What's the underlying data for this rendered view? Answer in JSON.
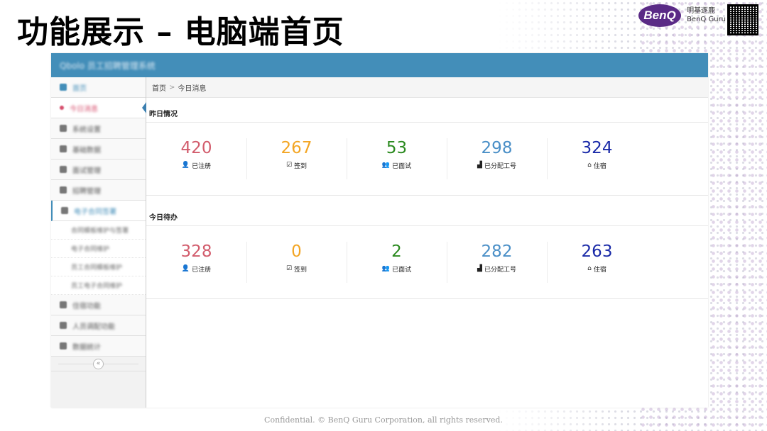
{
  "slide": {
    "title": "功能展示 – 电脑端首页",
    "brand_name": "BenQ",
    "brand_text_line1": "明基逐鹿",
    "brand_text_line2": "BenQ Guru",
    "footer": "Confidential.  © BenQ Guru Corporation, all rights reserved."
  },
  "app": {
    "title": "Qbolo 员工招聘管理系统"
  },
  "sidebar": {
    "items": [
      {
        "label": "首页"
      },
      {
        "label": "今日消息"
      },
      {
        "label": "系统设置"
      },
      {
        "label": "基础数据"
      },
      {
        "label": "面试管理"
      },
      {
        "label": "招聘管理"
      },
      {
        "label": "电子合同签署"
      }
    ],
    "sub_items": [
      {
        "label": "合同模板维护与签署"
      },
      {
        "label": "电子合同维护"
      },
      {
        "label": "员工合同模板维护"
      },
      {
        "label": "员工电子合同维护"
      }
    ],
    "items_after": [
      {
        "label": "住宿功能"
      },
      {
        "label": "人员调配功能"
      },
      {
        "label": "数据统计"
      }
    ],
    "collapse_glyph": "«"
  },
  "breadcrumb": {
    "home": "首页",
    "sep": ">",
    "current": "今日消息"
  },
  "sections": [
    {
      "title": "昨日情况",
      "stats": [
        {
          "value": "420",
          "label": "已注册",
          "icon": "user-icon",
          "glyph": "👤",
          "color": "#d25c6c"
        },
        {
          "value": "267",
          "label": "签到",
          "icon": "check-square-icon",
          "glyph": "☑",
          "color": "#f3a523"
        },
        {
          "value": "53",
          "label": "已面试",
          "icon": "group-icon",
          "glyph": "👥",
          "color": "#2b8a1f"
        },
        {
          "value": "298",
          "label": "已分配工号",
          "icon": "sitemap-icon",
          "glyph": "▟",
          "color": "#4a8fc7"
        },
        {
          "value": "324",
          "label": "住宿",
          "icon": "home-icon",
          "glyph": "⌂",
          "color": "#1a2aa8"
        }
      ]
    },
    {
      "title": "今日待办",
      "stats": [
        {
          "value": "328",
          "label": "已注册",
          "icon": "user-icon",
          "glyph": "👤",
          "color": "#d25c6c"
        },
        {
          "value": "0",
          "label": "签到",
          "icon": "check-square-icon",
          "glyph": "☑",
          "color": "#f3a523"
        },
        {
          "value": "2",
          "label": "已面试",
          "icon": "group-icon",
          "glyph": "👥",
          "color": "#2b8a1f"
        },
        {
          "value": "282",
          "label": "已分配工号",
          "icon": "sitemap-icon",
          "glyph": "▟",
          "color": "#4a8fc7"
        },
        {
          "value": "263",
          "label": "住宿",
          "icon": "home-icon",
          "glyph": "⌂",
          "color": "#1a2aa8"
        }
      ]
    }
  ]
}
